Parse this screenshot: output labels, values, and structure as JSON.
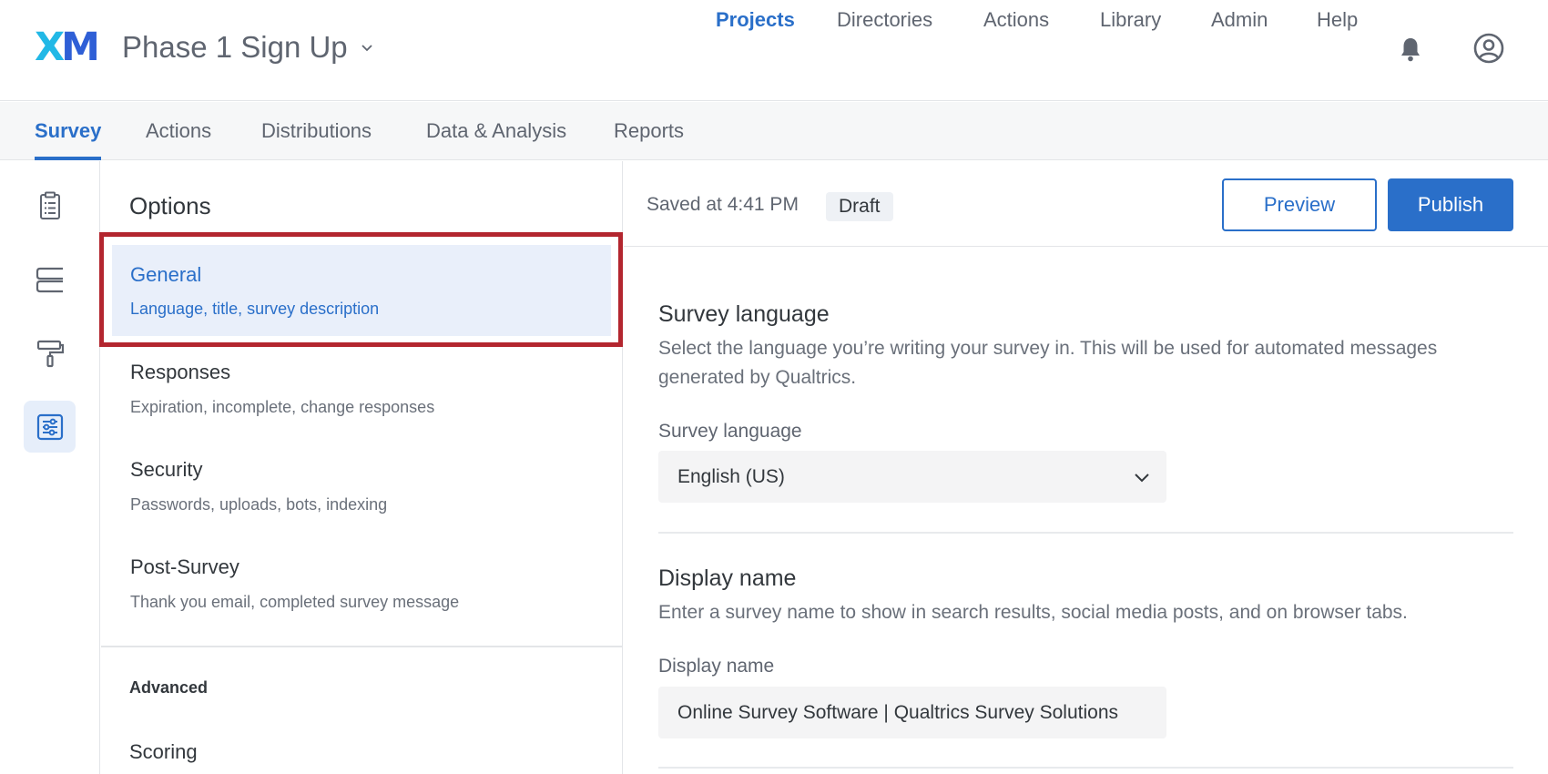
{
  "header": {
    "logo_x": "X",
    "logo_m": "M",
    "project_name": "Phase 1 Sign Up",
    "nav": [
      {
        "label": "Projects",
        "active": true
      },
      {
        "label": "Directories"
      },
      {
        "label": "Actions"
      },
      {
        "label": "Library"
      },
      {
        "label": "Admin"
      },
      {
        "label": "Help"
      }
    ],
    "icons": [
      "bell-icon",
      "account-icon"
    ]
  },
  "tabs": [
    {
      "label": "Survey",
      "active": true
    },
    {
      "label": "Actions"
    },
    {
      "label": "Distributions"
    },
    {
      "label": "Data & Analysis"
    },
    {
      "label": "Reports"
    }
  ],
  "rail": [
    "survey-flow-icon",
    "blocks-icon",
    "look-and-feel-icon",
    "survey-options-icon"
  ],
  "options": {
    "title": "Options",
    "items": [
      {
        "title": "General",
        "subtitle": "Language, title, survey description",
        "active": true
      },
      {
        "title": "Responses",
        "subtitle": "Expiration, incomplete, change responses"
      },
      {
        "title": "Security",
        "subtitle": "Passwords, uploads, bots, indexing"
      },
      {
        "title": "Post-Survey",
        "subtitle": "Thank you email, completed survey message"
      }
    ],
    "advanced_label": "Advanced",
    "scoring_label": "Scoring"
  },
  "status": {
    "saved": "Saved at 4:41 PM",
    "draft": "Draft",
    "preview": "Preview",
    "publish": "Publish"
  },
  "general": {
    "language": {
      "heading": "Survey language",
      "description": "Select the language you’re writing your survey in. This will be used for automated messages generated by Qualtrics.",
      "label": "Survey language",
      "value": "English (US)"
    },
    "display_name": {
      "heading": "Display name",
      "description": "Enter a survey name to show in search results, social media posts, and on browser tabs.",
      "label": "Display name",
      "value": "Online Survey Software | Qualtrics Survey Solutions"
    }
  },
  "colors": {
    "accent": "#2a6fc9",
    "highlight": "#b3262f",
    "logo_x": "#22b8e6",
    "logo_m": "#2f5fd6"
  }
}
